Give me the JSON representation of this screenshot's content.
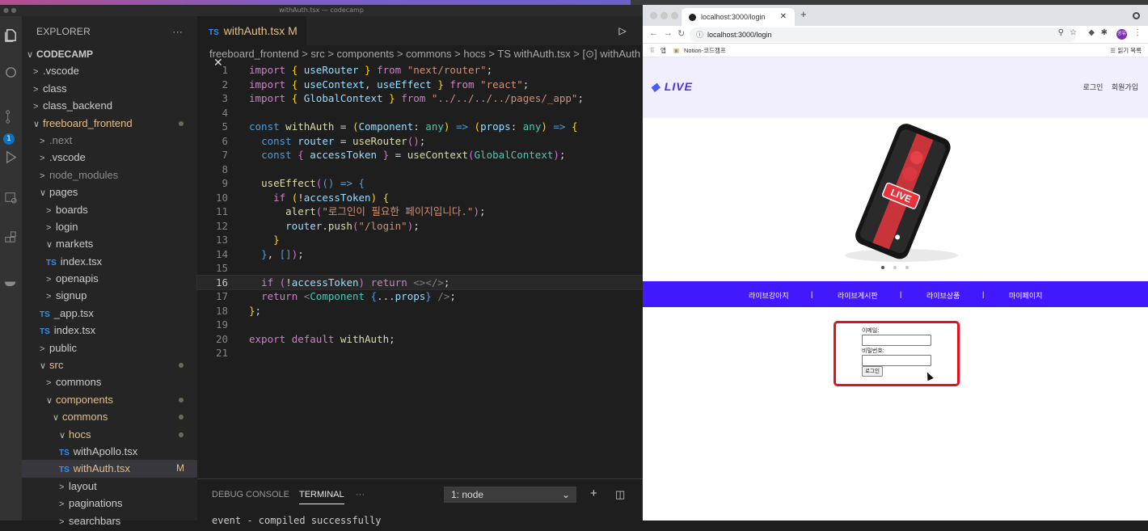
{
  "os": {
    "menubar": "top-strip"
  },
  "vscode": {
    "window_title": "withAuth.tsx — codecamp",
    "scm_badge": "1",
    "explorer": {
      "title": "EXPLORER",
      "more": "···",
      "tree": [
        {
          "label": "CODECAMP",
          "chev": "∨",
          "indent": 0,
          "bold": true
        },
        {
          "label": ".vscode",
          "chev": ">",
          "indent": 1
        },
        {
          "label": "class",
          "chev": ">",
          "indent": 1
        },
        {
          "label": "class_backend",
          "chev": ">",
          "indent": 1
        },
        {
          "label": "freeboard_frontend",
          "chev": "∨",
          "indent": 1,
          "modified": true,
          "dot": true
        },
        {
          "label": ".next",
          "chev": ">",
          "indent": 2,
          "dim": true
        },
        {
          "label": ".vscode",
          "chev": ">",
          "indent": 2
        },
        {
          "label": "node_modules",
          "chev": ">",
          "indent": 2,
          "dim": true
        },
        {
          "label": "pages",
          "chev": "∨",
          "indent": 2
        },
        {
          "label": "boards",
          "chev": ">",
          "indent": 3
        },
        {
          "label": "login",
          "chev": ">",
          "indent": 3
        },
        {
          "label": "markets",
          "chev": "∨",
          "indent": 3
        },
        {
          "label": "index.tsx",
          "ts": true,
          "indent": 3
        },
        {
          "label": "openapis",
          "chev": ">",
          "indent": 3
        },
        {
          "label": "signup",
          "chev": ">",
          "indent": 3
        },
        {
          "label": "_app.tsx",
          "ts": true,
          "indent": 2
        },
        {
          "label": "index.tsx",
          "ts": true,
          "indent": 2
        },
        {
          "label": "public",
          "chev": ">",
          "indent": 2
        },
        {
          "label": "src",
          "chev": "∨",
          "indent": 2,
          "modified": true,
          "dot": true
        },
        {
          "label": "commons",
          "chev": ">",
          "indent": 3
        },
        {
          "label": "components",
          "chev": "∨",
          "indent": 3,
          "modified": true,
          "dot": true
        },
        {
          "label": "commons",
          "chev": "∨",
          "indent": 4,
          "modified": true,
          "dot": true
        },
        {
          "label": "hocs",
          "chev": "∨",
          "indent": 5,
          "modified": true,
          "dot": true
        },
        {
          "label": "withApollo.tsx",
          "ts": true,
          "indent": 5
        },
        {
          "label": "withAuth.tsx",
          "ts": true,
          "indent": 5,
          "modified": true,
          "selected": true,
          "marker": "M"
        },
        {
          "label": "layout",
          "chev": ">",
          "indent": 5
        },
        {
          "label": "paginations",
          "chev": ">",
          "indent": 5
        },
        {
          "label": "searchbars",
          "chev": ">",
          "indent": 5
        }
      ]
    },
    "tab": {
      "ts": "TS",
      "name": "withAuth.tsx",
      "state": "M",
      "close": "✕"
    },
    "breadcrumb": "freeboard_frontend > src > components > commons > hocs > TS withAuth.tsx > [⊙] withAuth >",
    "code_lines": [
      "<span class=k>import</span> <span class=y>{</span> <span class=v>useRouter</span> <span class=y>}</span> <span class=k>from</span> <span class=s>\"next/router\"</span>;",
      "<span class=k>import</span> <span class=y>{</span> <span class=v>useContext</span>, <span class=v>useEffect</span> <span class=y>}</span> <span class=k>from</span> <span class=s>\"react\"</span>;",
      "<span class=k>import</span> <span class=y>{</span> <span class=v>GlobalContext</span> <span class=y>}</span> <span class=k>from</span> <span class=s>\"../../../../pages/_app\"</span>;",
      "",
      "<span class=b>const</span> <span class=f>withAuth</span> = <span class=y>(</span><span class=v>Component</span>: <span class=c>any</span><span class=y>)</span> <span class=b>=&gt;</span> <span class=y>(</span><span class=v>props</span>: <span class=c>any</span><span class=y>)</span> <span class=b>=&gt;</span> <span class=y>{</span>",
      "  <span class=b>const</span> <span class=v>router</span> = <span class=f>useRouter</span><span class=p>()</span>;",
      "  <span class=b>const</span> <span class=p>{</span> <span class=v>accessToken</span> <span class=p>}</span> = <span class=f>useContext</span><span class=p>(</span><span class=c>GlobalContext</span><span class=p>)</span>;",
      "",
      "  <span class=f>useEffect</span><span class=p>(</span><span class=b>()</span> <span class=b>=&gt;</span> <span class=b>{</span>",
      "    <span class=k>if</span> <span class=y>(</span>!<span class=v>accessToken</span><span class=y>)</span> <span class=y>{</span>",
      "      <span class=f>alert</span><span class=p>(</span><span class=s>\"로그인이 필요한 페이지입니다.\"</span><span class=p>)</span>;",
      "      <span class=v>router</span>.<span class=f>push</span><span class=p>(</span><span class=s>\"/login\"</span><span class=p>)</span>;",
      "    <span class=y>}</span>",
      "  <span class=b>}</span>, <span class=b>[]</span><span class=p>)</span>;",
      "",
      "  <span class=k>if</span> <span class=p>(</span>!<span class=v>accessToken</span><span class=p>)</span> <span class=k>return</span> <span class=g>&lt;&gt;&lt;/&gt;</span>;",
      "  <span class=k>return</span> <span class=g>&lt;</span><span class=c>Component</span> <span class=b>{</span>...<span class=v>props</span><span class=b>}</span> <span class=g>/&gt;</span>;",
      "<span class=y>}</span>;",
      "",
      "<span class=k>export</span> <span class=k>default</span> <span class=f>withAuth</span>;",
      ""
    ],
    "current_line": 16,
    "panel": {
      "tabs": [
        "DEBUG CONSOLE",
        "TERMINAL"
      ],
      "active": "TERMINAL",
      "more": "···",
      "selected_terminal": "1: node",
      "terminal_text": "event - compiled successfully"
    }
  },
  "chrome": {
    "tab_title": "localhost:3000/login",
    "url": "localhost:3000/login",
    "bookmarks": [
      "앱",
      "Notion-코드캠프"
    ],
    "reading_list": "읽기 목록",
    "profile_initials": "공유",
    "page": {
      "logo": "LIVE",
      "auth_links": [
        "로그인",
        "회원가입"
      ],
      "carousel_dots": 3,
      "menu": [
        "라이브강아지",
        "|",
        "라이브게시판",
        "|",
        "라이브상품",
        "|",
        "마이페이지"
      ],
      "form": {
        "email_label": "이메일:",
        "password_label": "비밀번호:",
        "submit": "로그인",
        "highlight_color": "#e8101e"
      }
    }
  },
  "colors": {
    "accent": "#4219ff",
    "editor_bg": "#1e1e1e",
    "modified": "#e2c08d",
    "ts": "#3b8eea"
  }
}
